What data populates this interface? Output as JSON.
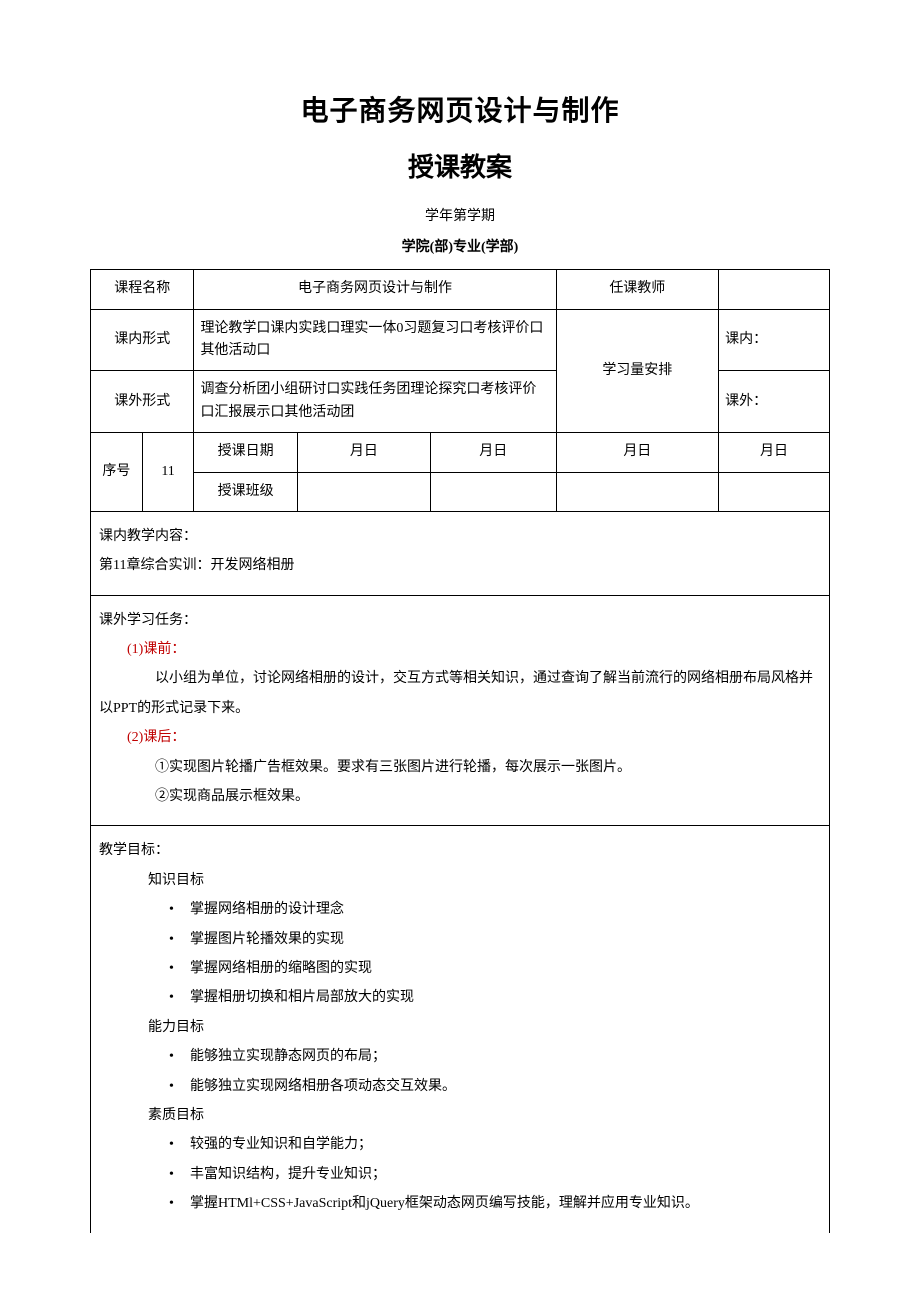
{
  "title1": "电子商务网页设计与制作",
  "title2": "授课教案",
  "semester_line": "学年第学期",
  "faculty_line": "学院(部)专业(学部)",
  "labels": {
    "course_name": "课程名称",
    "course_value": "电子商务网页设计与制作",
    "teacher": "任课教师",
    "in_class_form": "课内形式",
    "in_class_form_value": "理论教学口课内实践口理实一体0习题复习口考核评价口其他活动口",
    "out_class_form": "课外形式",
    "out_class_form_value": "调查分析团小组研讨口实践任务团理论探究口考核评价口汇报展示口其他活动团",
    "study_arrange": "学习量安排",
    "in_class": "课内：",
    "out_class": "课外：",
    "seq": "序号",
    "seq_value": "11",
    "teach_date": "授课日期",
    "teach_class": "授课班级",
    "month_day": "月日"
  },
  "sections": {
    "in_content_h": "课内教学内容：",
    "in_content_body": "第11章综合实训：开发网络相册",
    "out_task_h": "课外学习任务：",
    "pre_class": "(1)课前：",
    "pre_class_body": "以小组为单位，讨论网络相册的设计，交互方式等相关知识，通过查询了解当前流行的网络相册布局风格并以PPT的形式记录下来。",
    "post_class": "(2)课后：",
    "post_item1": "①实现图片轮播广告框效果。要求有三张图片进行轮播，每次展示一张图片。",
    "post_item2": "②实现商品展示框效果。",
    "goal_h": "教学目标：",
    "knowledge_h": "知识目标",
    "knowledge": [
      "掌握网络相册的设计理念",
      "掌握图片轮播效果的实现",
      "掌握网络相册的缩略图的实现",
      "掌握相册切换和相片局部放大的实现"
    ],
    "ability_h": "能力目标",
    "ability": [
      "能够独立实现静态网页的布局；",
      "能够独立实现网络相册各项动态交互效果。"
    ],
    "quality_h": "素质目标",
    "quality": [
      "较强的专业知识和自学能力；",
      "丰富知识结构，提升专业知识；",
      "掌握HTMl+CSS+JavaScript和jQuery框架动态网页编写技能，理解并应用专业知识。"
    ]
  }
}
